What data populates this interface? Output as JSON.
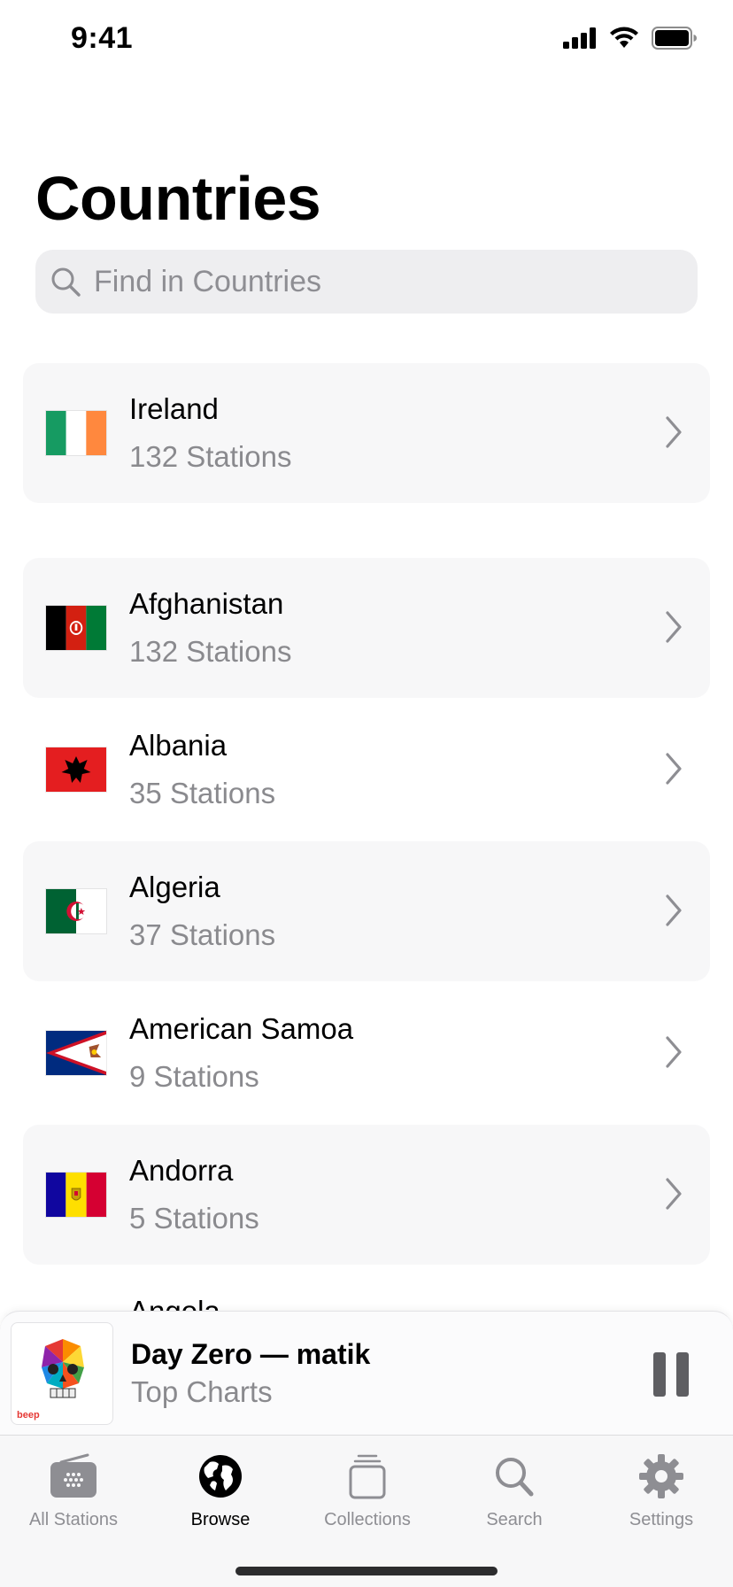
{
  "status_bar": {
    "time": "9:41"
  },
  "page": {
    "title": "Countries"
  },
  "search": {
    "placeholder": "Find in Countries"
  },
  "featured": {
    "name": "Ireland",
    "count": "132 Stations"
  },
  "countries": [
    {
      "name": "Afghanistan",
      "count": "132 Stations"
    },
    {
      "name": "Albania",
      "count": "35 Stations"
    },
    {
      "name": "Algeria",
      "count": "37 Stations"
    },
    {
      "name": "American Samoa",
      "count": "9 Stations"
    },
    {
      "name": "Andorra",
      "count": "5 Stations"
    }
  ],
  "partial_row": {
    "name": "Angola"
  },
  "now_playing": {
    "title": "Day Zero — matik",
    "subtitle": "Top Charts",
    "artwork_badge": "beep"
  },
  "tabs": [
    {
      "label": "All Stations",
      "icon": "radio-icon"
    },
    {
      "label": "Browse",
      "icon": "globe-icon",
      "active": true
    },
    {
      "label": "Collections",
      "icon": "collections-icon"
    },
    {
      "label": "Search",
      "icon": "search-icon"
    },
    {
      "label": "Settings",
      "icon": "gear-icon"
    }
  ],
  "colors": {
    "accent": "#000000",
    "secondary_text": "#8a8a8e",
    "row_background": "#f7f7f8"
  }
}
